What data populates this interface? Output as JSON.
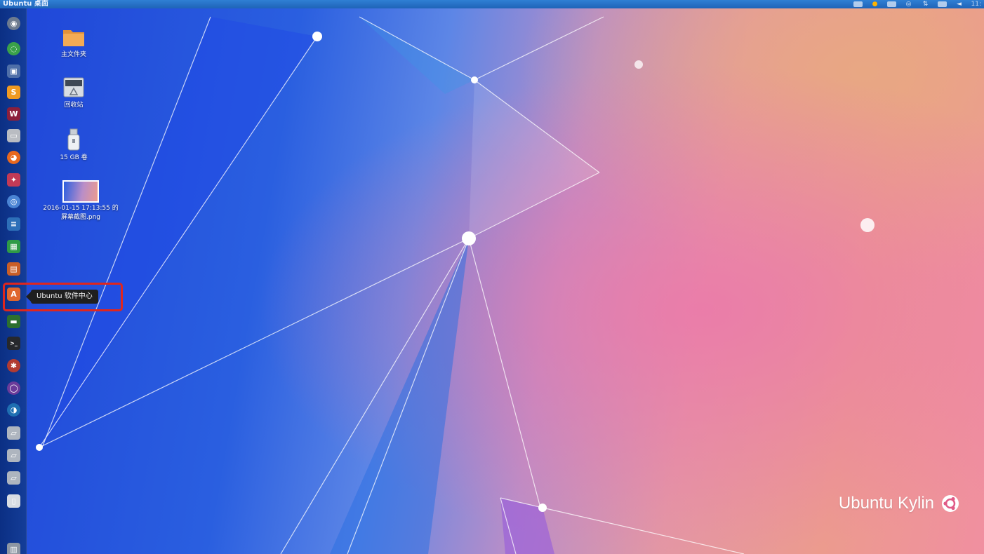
{
  "panel": {
    "title": "Ubuntu 桌面",
    "clock": "11:",
    "tray_icons": [
      "dropbox-icon",
      "sogou-input-icon",
      "keyboard-icon",
      "network-icon",
      "transfer-icon",
      "mail-icon",
      "volume-icon"
    ]
  },
  "launcher": {
    "items": [
      {
        "name": "dash-icon"
      },
      {
        "name": "software-updater-icon"
      },
      {
        "name": "kylin-assistant-icon"
      },
      {
        "name": "sublime-text-icon"
      },
      {
        "name": "wps-icon"
      },
      {
        "name": "files-icon"
      },
      {
        "name": "firefox-icon"
      },
      {
        "name": "youker-assistant-icon"
      },
      {
        "name": "chromium-icon"
      },
      {
        "name": "libreoffice-writer-icon"
      },
      {
        "name": "libreoffice-calc-icon"
      },
      {
        "name": "libreoffice-impress-icon"
      },
      {
        "name": "ubuntu-software-center-icon"
      },
      {
        "name": "image-viewer-icon"
      },
      {
        "name": "terminal-icon"
      },
      {
        "name": "system-settings-icon"
      },
      {
        "name": "media-player-icon"
      },
      {
        "name": "cleaner-icon"
      },
      {
        "name": "drive-icon"
      },
      {
        "name": "drive-icon"
      },
      {
        "name": "drive-icon"
      },
      {
        "name": "usb-drive-icon"
      },
      {
        "name": "trash-icon"
      }
    ]
  },
  "desktop": {
    "icons": [
      {
        "label": "主文件夹",
        "icon": "home-folder-icon"
      },
      {
        "label": "回收站",
        "icon": "trash-icon"
      },
      {
        "label": "15 GB 卷",
        "icon": "usb-drive-icon"
      },
      {
        "label": "2016-01-15 17:13:55 的屏幕截图.png",
        "icon": "screenshot-thumbnail"
      }
    ]
  },
  "tooltip": {
    "label": "Ubuntu 软件中心"
  },
  "highlight_color": "#e0261d",
  "watermark": {
    "text": "Ubuntu Kylin"
  }
}
